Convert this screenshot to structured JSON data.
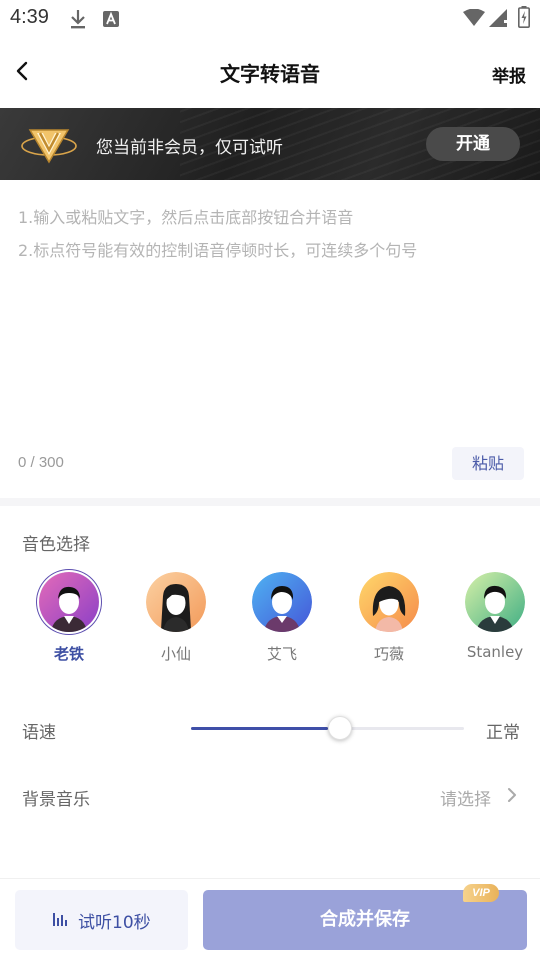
{
  "status_bar": {
    "time": "4:39"
  },
  "header": {
    "title": "文字转语音",
    "report_label": "举报"
  },
  "vip_banner": {
    "message": "您当前非会员，仅可试听",
    "open_label": "开通"
  },
  "text_input": {
    "hint_1": "1.输入或粘贴文字，然后点击底部按钮合并语音",
    "hint_2": "2.标点符号能有效的控制语音停顿时长，可连续多个句号",
    "char_count": "0 / 300",
    "paste_label": "粘贴"
  },
  "voice": {
    "section_label": "音色选择",
    "items": [
      {
        "name": "老铁",
        "selected": true
      },
      {
        "name": "小仙",
        "selected": false
      },
      {
        "name": "艾飞",
        "selected": false
      },
      {
        "name": "巧薇",
        "selected": false
      },
      {
        "name": "Stanley",
        "selected": false
      }
    ]
  },
  "speed": {
    "label": "语速",
    "value_label": "正常",
    "level": 0.5
  },
  "bg_music": {
    "label": "背景音乐",
    "value": "请选择"
  },
  "bottom": {
    "preview_label": "试听10秒",
    "save_label": "合成并保存",
    "vip_tag": "VIP"
  },
  "colors": {
    "accent": "#3d4fa3",
    "save_button": "#9aa2d9",
    "vip_gold": "#e9b25a"
  }
}
